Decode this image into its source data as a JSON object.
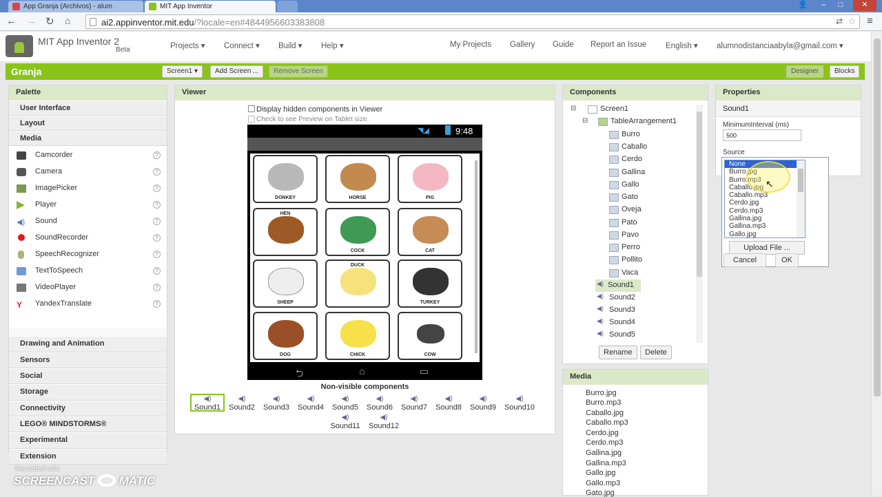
{
  "browser": {
    "tabs": [
      {
        "label": "App Granja (Archivos) - alum"
      },
      {
        "label": "MIT App Inventor"
      }
    ],
    "url_host": "ai2.appinventor.mit.edu",
    "url_rest": "/?locale=en#4844956603383808",
    "controls": {
      "minimize": "–",
      "maximize": "□",
      "close": "✕",
      "user": "👤"
    }
  },
  "app": {
    "title": "MIT App Inventor 2",
    "beta": "Beta",
    "menu": [
      "Projects ▾",
      "Connect ▾",
      "Build ▾",
      "Help ▾"
    ],
    "right_menu": [
      "My Projects",
      "Gallery",
      "Guide",
      "Report an Issue",
      "English ▾",
      "alumnodistanciaabyla@gmail.com ▾"
    ]
  },
  "project": {
    "name": "Granja",
    "screen_btn": "Screen1 ▾",
    "add_screen": "Add Screen ...",
    "remove_screen": "Remove Screen",
    "designer": "Designer",
    "blocks": "Blocks"
  },
  "palette": {
    "title": "Palette",
    "categories_top": [
      "User Interface",
      "Layout",
      "Media"
    ],
    "media_items": [
      "Camcorder",
      "Camera",
      "ImagePicker",
      "Player",
      "Sound",
      "SoundRecorder",
      "SpeechRecognizer",
      "TextToSpeech",
      "VideoPlayer",
      "YandexTranslate"
    ],
    "categories_bottom": [
      "Drawing and Animation",
      "Sensors",
      "Social",
      "Storage",
      "Connectivity",
      "LEGO® MINDSTORMS®",
      "Experimental",
      "Extension"
    ],
    "help": "?"
  },
  "viewer": {
    "title": "Viewer",
    "chk_hidden": "Display hidden components in Viewer",
    "chk_tablet": "Check to see Preview on Tablet size.",
    "time": "9:48",
    "nonvisible_title": "Non-visible components",
    "grid": [
      "DONKEY",
      "HORSE",
      "PIG",
      "HEN",
      "COCK",
      "CAT",
      "SHEEP",
      "DUCK",
      "TURKEY",
      "DOG",
      "CHICK",
      "COW"
    ],
    "nonvisible": [
      "Sound1",
      "Sound2",
      "Sound3",
      "Sound4",
      "Sound5",
      "Sound6",
      "Sound7",
      "Sound8",
      "Sound9",
      "Sound10",
      "Sound11",
      "Sound12"
    ],
    "nav": {
      "back": "⮌",
      "home": "⌂",
      "recent": "▭"
    }
  },
  "components": {
    "title": "Components",
    "screen": "Screen1",
    "table": "TableArrangement1",
    "images": [
      "Burro",
      "Caballo",
      "Cerdo",
      "Gallina",
      "Gallo",
      "Gato",
      "Oveja",
      "Pato",
      "Pavo",
      "Perro",
      "Pollito",
      "Vaca"
    ],
    "sounds": [
      "Sound1",
      "Sound2",
      "Sound3",
      "Sound4",
      "Sound5"
    ],
    "rename": "Rename",
    "delete": "Delete"
  },
  "media": {
    "title": "Media",
    "files": [
      "Burro.jpg",
      "Burro.mp3",
      "Caballo.jpg",
      "Caballo.mp3",
      "Cerdo.jpg",
      "Cerdo.mp3",
      "Gallina.jpg",
      "Gallina.mp3",
      "Gallo.jpg",
      "Gallo.mp3",
      "Gato.jpg"
    ]
  },
  "properties": {
    "title": "Properties",
    "component": "Sound1",
    "min_label": "MinimumInterval (ms)",
    "min_value": "500",
    "source_label": "Source",
    "options": [
      "None",
      "Burro.jpg",
      "Burro.mp3",
      "Caballo.jpg",
      "Caballo.mp3",
      "Cerdo.jpg",
      "Cerdo.mp3",
      "Gallina.jpg",
      "Gallina.mp3",
      "Gallo.jpg"
    ],
    "upload": "Upload File ...",
    "cancel": "Cancel",
    "ok": "OK"
  },
  "watermark": {
    "line1": "Recorded with",
    "line2": "SCREENCAST",
    "line3": "MATIC"
  },
  "colors": {
    "green": "#8ac418",
    "panel_head": "#dbe9c9",
    "selected": "#2d63d5"
  }
}
